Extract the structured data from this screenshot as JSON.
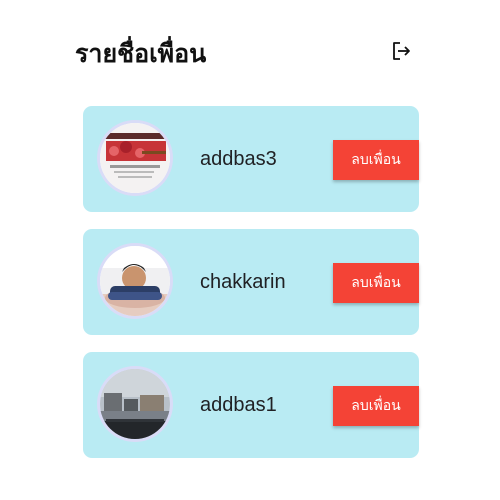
{
  "header": {
    "title": "รายชื่อเพื่อน",
    "logout_icon": "logout-icon"
  },
  "colors": {
    "card_background": "#b9ebf3",
    "remove_button": "#f44336"
  },
  "friends": [
    {
      "name": "addbas3",
      "remove_label": "ลบเพื่อน",
      "avatar": "event-banner-photo"
    },
    {
      "name": "chakkarin",
      "remove_label": "ลบเพื่อน",
      "avatar": "person-photo"
    },
    {
      "name": "addbas1",
      "remove_label": "ลบเพื่อน",
      "avatar": "street-view-photo"
    }
  ]
}
